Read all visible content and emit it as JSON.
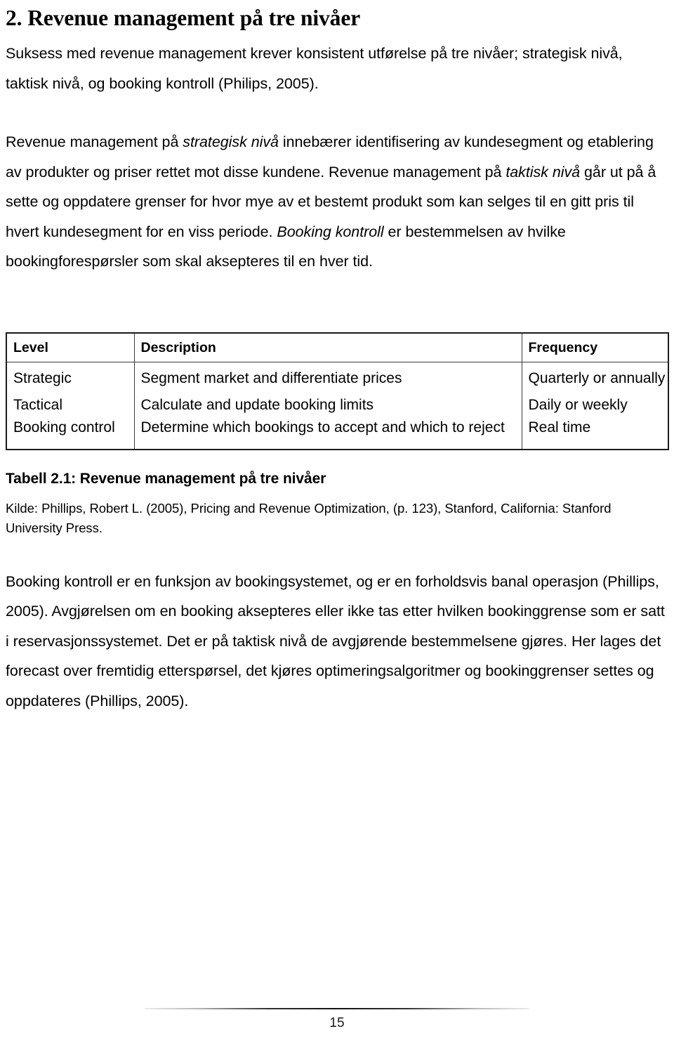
{
  "document": {
    "heading": "2. Revenue management på tre nivåer",
    "intro_paragraph": "Suksess med revenue management krever konsistent utførelse på tre nivåer; strategisk nivå, taktisk nivå, og booking kontroll (Philips, 2005).",
    "paragraph_2": {
      "seg1": "Revenue management på ",
      "em1": "strategisk nivå",
      "seg2": " innebærer identifisering av kundesegment og etablering av produkter og priser rettet mot disse kundene. Revenue management på ",
      "em2": "taktisk nivå",
      "seg3": " går ut på å sette og oppdatere grenser for hvor mye av et bestemt produkt som kan selges til en gitt pris til hvert kundesegment for en viss periode. ",
      "em3": "Booking kontroll",
      "seg4": " er bestemmelsen av hvilke bookingforespørsler som skal aksepteres til en hver tid."
    },
    "paragraph_3": "Booking kontroll er en funksjon av bookingsystemet, og er en forholdsvis banal operasjon (Phillips, 2005). Avgjørelsen om en booking aksepteres eller ikke tas etter hvilken bookinggrense som er satt i reservasjonssystemet. Det er på taktisk nivå de avgjørende bestemmelsene gjøres. Her lages det forecast over fremtidig etterspørsel, det kjøres optimeringsalgoritmer og bookinggrenser settes og oppdateres (Phillips, 2005)."
  },
  "table": {
    "headers": {
      "level": "Level",
      "description": "Description",
      "frequency": "Frequency"
    },
    "rows": [
      {
        "level": "Strategic",
        "description": "Segment market and differentiate prices",
        "frequency": "Quarterly or annually"
      },
      {
        "level": "Tactical",
        "description": "Calculate and update booking limits",
        "frequency": "Daily or weekly"
      },
      {
        "level": "Booking control",
        "description": "Determine which bookings to accept and which to reject",
        "frequency": "Real time"
      }
    ],
    "caption": "Tabell 2.1: Revenue management på tre nivåer",
    "source": "Kilde: Phillips, Robert L. (2005), Pricing and Revenue Optimization, (p. 123), Stanford, California: Stanford University Press."
  },
  "footer": {
    "page_number": "15"
  }
}
